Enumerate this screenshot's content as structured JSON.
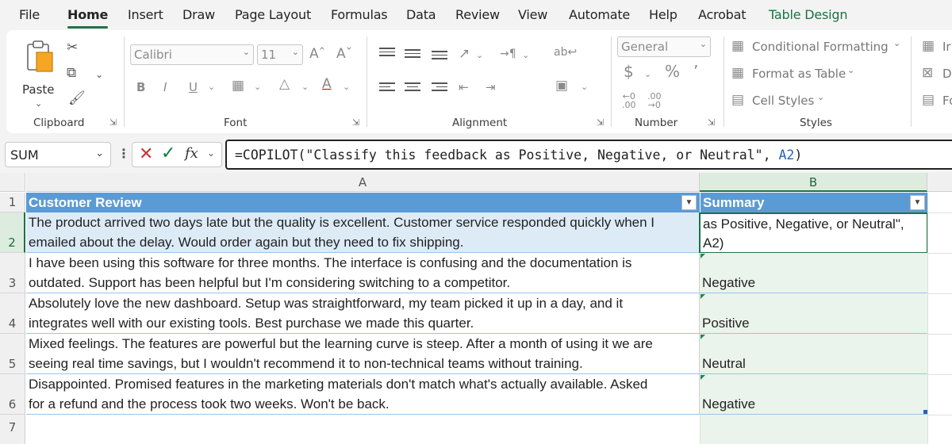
{
  "tabs": [
    "File",
    "Home",
    "Insert",
    "Draw",
    "Page Layout",
    "Formulas",
    "Data",
    "Review",
    "View",
    "Automate",
    "Help",
    "Acrobat",
    "Table Design"
  ],
  "active_tab": "Home",
  "ribbon": {
    "clipboard": {
      "paste_label": "Paste",
      "group_label": "Clipboard"
    },
    "font": {
      "font_name": "Calibri",
      "font_size": "11",
      "group_label": "Font"
    },
    "alignment": {
      "group_label": "Alignment"
    },
    "number": {
      "format": "General",
      "group_label": "Number"
    },
    "styles": {
      "conditional_formatting": "Conditional Formatting",
      "format_as_table": "Format as Table",
      "cell_styles": "Cell Styles",
      "group_label": "Styles"
    },
    "cells": {
      "insert": "Ir",
      "delete": "D",
      "format": "Fo"
    }
  },
  "formula_bar": {
    "name_box": "SUM",
    "fx_label": "fx",
    "formula_text": "=COPILOT(\"Classify this feedback as Positive, Negative, or Neutral\", ",
    "formula_ref": "A2",
    "formula_end": ")"
  },
  "sheet": {
    "columns": [
      "A",
      "B"
    ],
    "row_numbers": [
      "1",
      "2",
      "3",
      "4",
      "5",
      "6",
      "7"
    ],
    "headers": {
      "a": "Customer Review",
      "b": "Summary"
    },
    "rows": [
      {
        "review_line1": "The product arrived two days late but the quality is excellent. Customer service responded quickly when I",
        "review_line2": "emailed about the delay. Would order again but they need to fix shipping.",
        "summary": "as Positive, Negative, or Neutral\", A2)"
      },
      {
        "review_line1": "I have been using this software for three months. The interface is confusing and the documentation is",
        "review_line2": "outdated. Support has been helpful but I'm considering switching to a competitor.",
        "summary": "Negative"
      },
      {
        "review_line1": "Absolutely love the new dashboard. Setup was straightforward, my team picked it up in a day, and it",
        "review_line2": "integrates well with our existing tools. Best purchase we made this quarter.",
        "summary": "Positive"
      },
      {
        "review_line1": "Mixed feelings. The features are powerful but the learning curve is steep. After a month of using it we are",
        "review_line2": "seeing real time savings, but I wouldn't recommend it to non-technical teams without training.",
        "summary": "Neutral"
      },
      {
        "review_line1": "Disappointed. Promised features in the marketing materials don't match what's actually available. Asked",
        "review_line2": "for a refund and the process took two weeks. Won't be back.",
        "summary": "Negative"
      }
    ]
  },
  "colors": {
    "accent_green": "#1f7244",
    "table_header_blue": "#5b9bd5",
    "cancel_red": "#d13438",
    "enter_green": "#107c41"
  }
}
